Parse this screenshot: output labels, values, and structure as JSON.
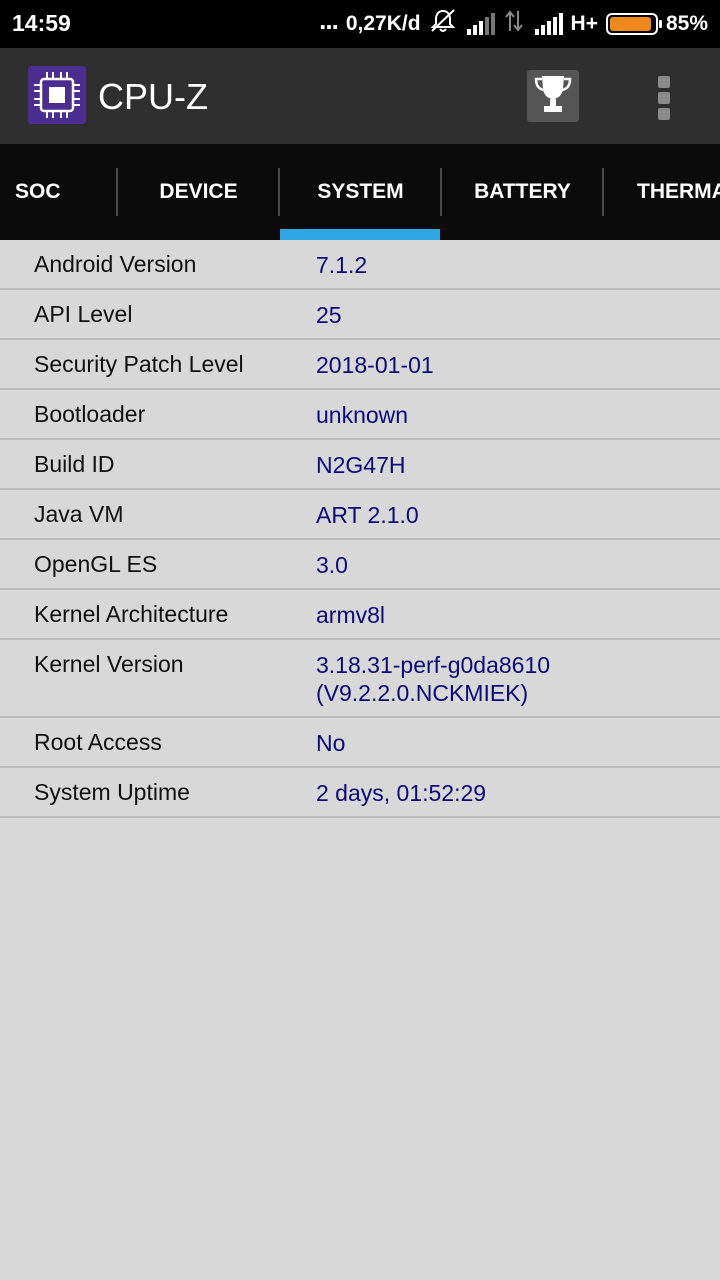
{
  "status_bar": {
    "time": "14:59",
    "dots": "...",
    "net_speed": "0,27K/d",
    "network_type": "H+",
    "battery_percent": "85%",
    "battery_level": 0.85,
    "battery_color": "#f28a1b"
  },
  "app_bar": {
    "title": "CPU-Z",
    "icon": "cpu-chip-icon",
    "actions": [
      "trophy-icon",
      "overflow-menu-icon"
    ]
  },
  "tabs": {
    "items": [
      {
        "label": "SOC"
      },
      {
        "label": "DEVICE"
      },
      {
        "label": "SYSTEM"
      },
      {
        "label": "BATTERY"
      },
      {
        "label": "THERMA"
      }
    ],
    "selected": "SYSTEM",
    "indicator_color": "#2fa6e0"
  },
  "system": {
    "rows": [
      {
        "label": "Android Version",
        "value": "7.1.2"
      },
      {
        "label": "API Level",
        "value": "25"
      },
      {
        "label": "Security Patch Level",
        "value": "2018-01-01"
      },
      {
        "label": "Bootloader",
        "value": "unknown"
      },
      {
        "label": "Build ID",
        "value": "N2G47H"
      },
      {
        "label": "Java VM",
        "value": "ART 2.1.0"
      },
      {
        "label": "OpenGL ES",
        "value": "3.0"
      },
      {
        "label": "Kernel Architecture",
        "value": "armv8l"
      },
      {
        "label": "Kernel Version",
        "value": "3.18.31-perf-g0da8610\n(V9.2.2.0.NCKMIEK)"
      },
      {
        "label": "Root Access",
        "value": "No"
      },
      {
        "label": "System Uptime",
        "value": "2 days, 01:52:29"
      }
    ]
  }
}
